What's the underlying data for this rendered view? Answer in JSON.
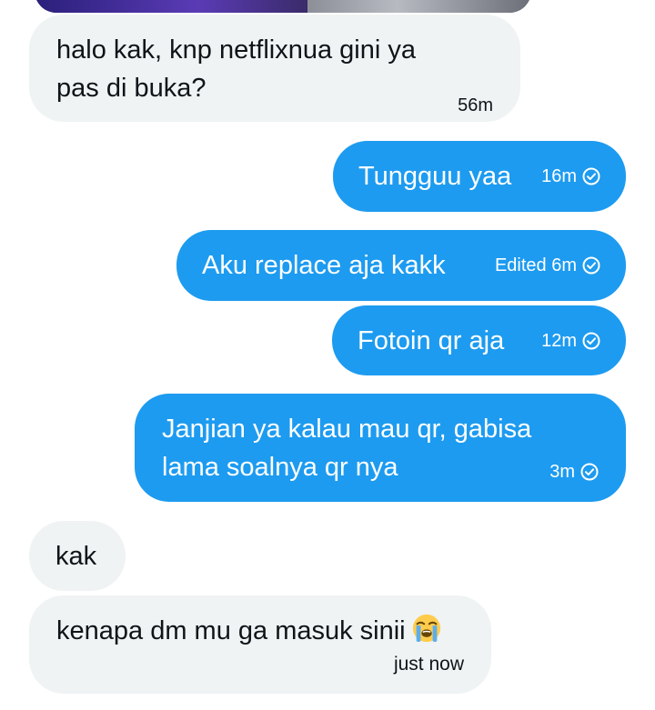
{
  "messages": [
    {
      "id": "m1",
      "direction": "incoming",
      "lines": [
        "halo kak, knp netflixnua gini ya",
        "pas di buka?"
      ],
      "time": "56m"
    },
    {
      "id": "m2",
      "direction": "outgoing",
      "text": "Tungguu yaa",
      "time": "16m",
      "status_icon": "check-circle-icon"
    },
    {
      "id": "m3",
      "direction": "outgoing",
      "text": "Aku replace aja kakk",
      "time": "Edited 6m",
      "status_icon": "check-circle-icon"
    },
    {
      "id": "m4",
      "direction": "outgoing",
      "text": "Fotoin qr aja",
      "time": "12m",
      "status_icon": "check-circle-icon"
    },
    {
      "id": "m5",
      "direction": "outgoing",
      "lines": [
        "Janjian ya kalau mau qr, gabisa",
        "lama soalnya qr nya"
      ],
      "time": "3m",
      "status_icon": "check-circle-icon"
    },
    {
      "id": "m6",
      "direction": "incoming",
      "text": "kak"
    },
    {
      "id": "m7",
      "direction": "incoming",
      "text": "kenapa dm mu ga masuk sinii",
      "emoji": "loudly-crying-face-emoji",
      "time": "just now"
    }
  ],
  "colors": {
    "outgoing_bubble": "#1d9bf0",
    "incoming_bubble": "#eff3f4",
    "incoming_text": "#0f1419",
    "outgoing_text": "#ffffff"
  }
}
